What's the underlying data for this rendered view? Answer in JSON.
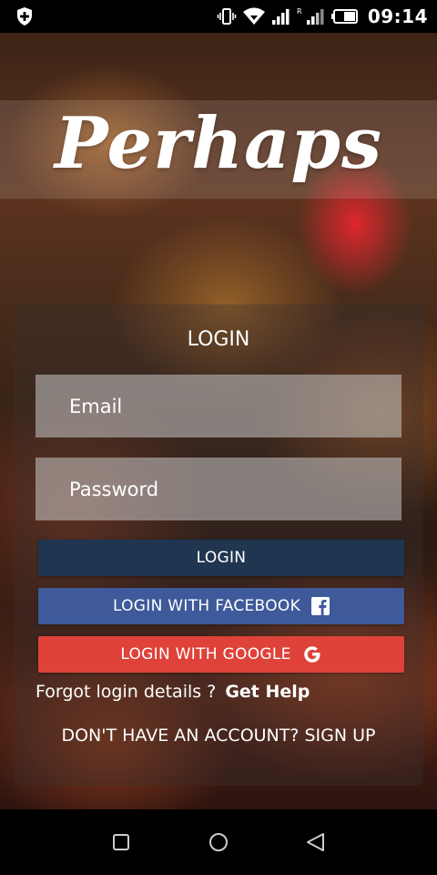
{
  "status_bar": {
    "time": "09:14",
    "icons": [
      "shield-plus-icon",
      "vibrate-icon",
      "wifi-icon",
      "signal-icon",
      "roaming-signal-icon",
      "battery-icon"
    ],
    "roaming_label": "R"
  },
  "app": {
    "title": "Perhaps"
  },
  "login_card": {
    "heading": "LOGIN",
    "email_placeholder": "Email",
    "password_placeholder": "Password",
    "login_button": "LOGIN",
    "facebook_button": "LOGIN WITH FACEBOOK",
    "google_button": "LOGIN WITH GOOGLE",
    "forgot_text": "Forgot login details ?",
    "get_help_link": "Get Help",
    "signup_link": "DON'T HAVE AN ACCOUNT? SIGN UP"
  },
  "nav_bar": {
    "buttons": [
      "recents-icon",
      "home-icon",
      "back-icon"
    ]
  },
  "colors": {
    "login_button": "#1f3550",
    "facebook_button": "#3e5a9a",
    "google_button": "#de4239"
  }
}
